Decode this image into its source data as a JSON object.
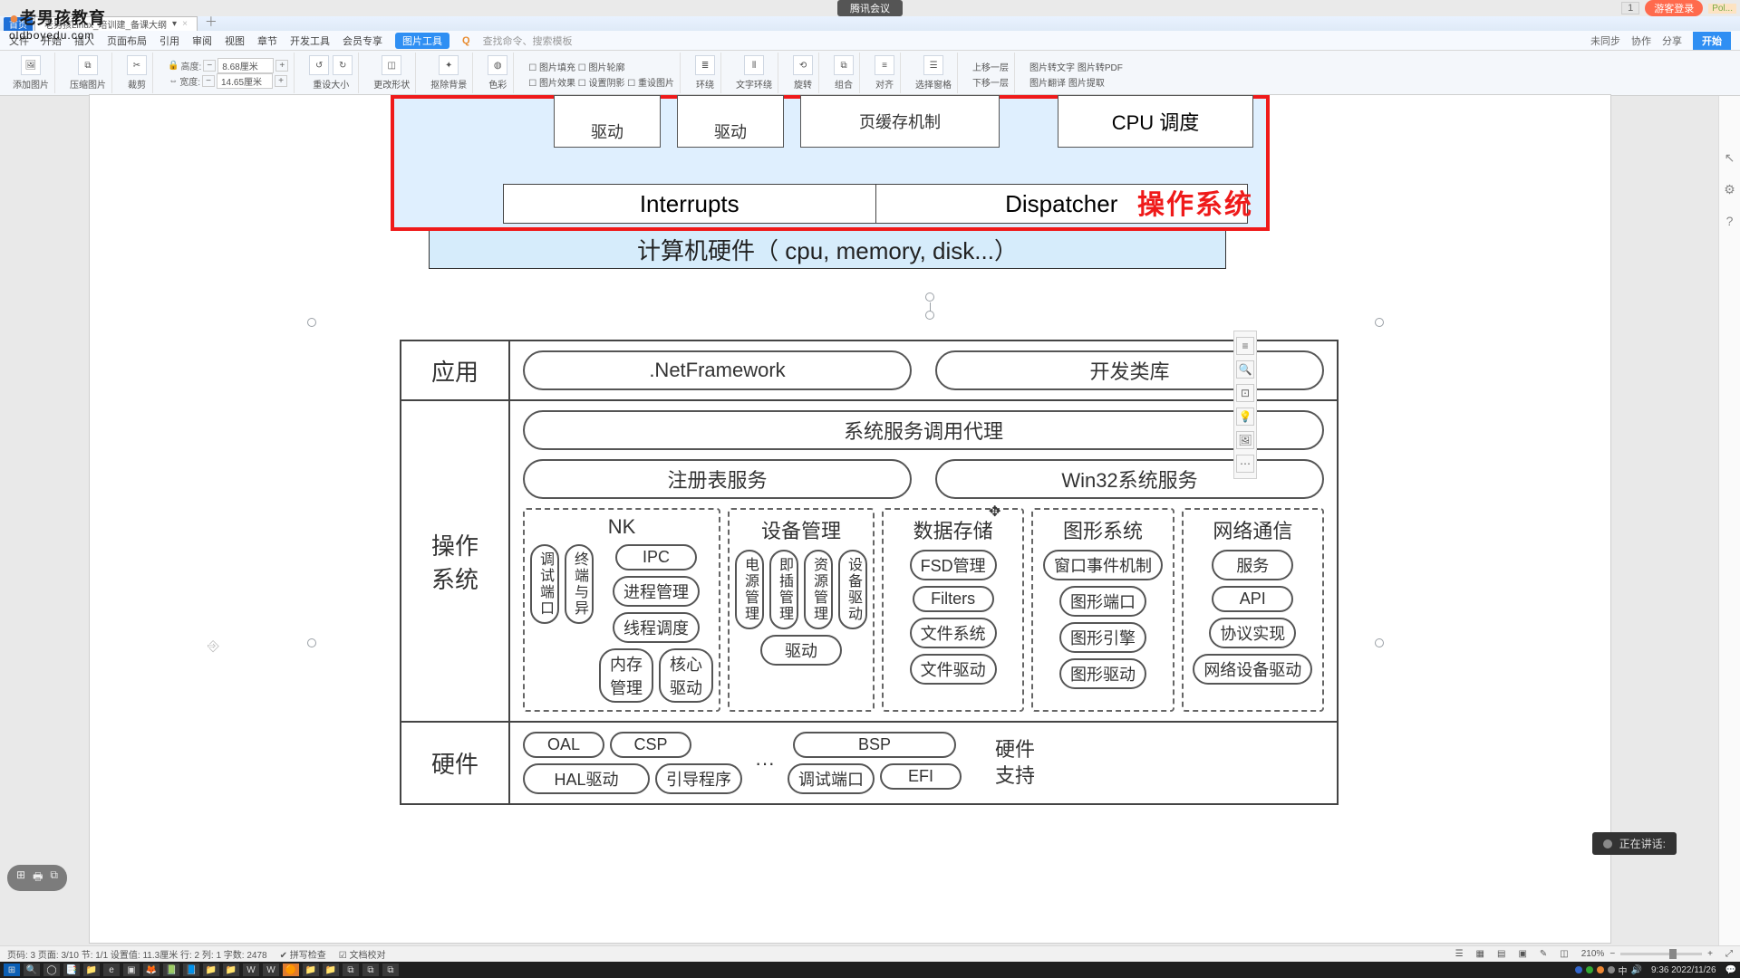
{
  "window": {
    "meeting_badge": "腾讯会议",
    "tab_prefix": "首页",
    "doc_tab": "老男孩Linux_培训建_备课大纲",
    "login": "游客登录",
    "counter": "1",
    "mini": "Pol..."
  },
  "menu": {
    "items": [
      "文件",
      "开始",
      "插入",
      "页面布局",
      "引用",
      "审阅",
      "视图",
      "章节",
      "开发工具",
      "会员专享"
    ],
    "active": "图片工具",
    "search_placeholder": "查找命令、搜索模板",
    "right": {
      "sync": "未同步",
      "coop": "协作",
      "share": "分享",
      "begin": "开始"
    }
  },
  "ribbon": {
    "add_pic": "添加图片",
    "compress": "压缩图片",
    "crop": "裁剪",
    "dim_h_lbl": "高度:",
    "dim_h_val": "8.68厘米",
    "dim_w_lbl": "宽度:",
    "dim_w_val": "14.65厘米",
    "reset": "重设大小",
    "shape": "更改形状",
    "rmbg": "抠除背景",
    "color": "色彩",
    "fill": "图片填充",
    "outline": "图片轮廓",
    "fx": "图片效果",
    "shadow": "设置阴影",
    "reset2": "重设图片",
    "wrap": "环绕",
    "align": "文字环绕",
    "rotate": "旋转",
    "combine": "组合",
    "align2": "对齐",
    "selpane": "选择窗格",
    "fwd": "上移一层",
    "back": "下移一层",
    "text": "图片转文字",
    "pdf": "图片转PDF",
    "translate": "图片翻译",
    "extract": "图片提取"
  },
  "logo": {
    "line1": "老男孩教育",
    "line2": "oldboyedu.com"
  },
  "diag_top": {
    "drv1": "驱动",
    "drv2": "驱动",
    "mem": "页缓存机制",
    "cpu": "CPU 调度",
    "os_label": "操作系统",
    "interrupts": "Interrupts",
    "dispatcher": "Dispatcher",
    "hw": "计算机硬件（ cpu, memory, disk...）"
  },
  "arch": {
    "r1": {
      "label": "应用",
      "netfx": ".NetFramework",
      "devlib": "开发类库"
    },
    "r2": {
      "label": "操作\n系统",
      "svc_proxy": "系统服务调用代理",
      "reg": "注册表服务",
      "win32": "Win32系统服务",
      "g_nk": {
        "title": "NK",
        "v1": "调试端口",
        "v2": "终端与异",
        "ipc": "IPC",
        "proc": "进程管理",
        "sched": "线程调度",
        "mem": "内存管理",
        "core": "核心驱动"
      },
      "g_dev": {
        "title": "设备管理",
        "v1": "电源管理",
        "v2": "即插管理",
        "v3": "资源管理",
        "v4": "设备驱动",
        "bottom": "驱动"
      },
      "g_store": {
        "title": "数据存储",
        "a": "FSD管理",
        "b": "Filters",
        "c": "文件系统",
        "d": "文件驱动"
      },
      "g_gfx": {
        "title": "图形系统",
        "a": "窗口事件机制",
        "b": "图形端口",
        "c": "图形引擎",
        "d": "图形驱动"
      },
      "g_net": {
        "title": "网络通信",
        "a": "服务",
        "b": "API",
        "c": "协议实现",
        "d": "网络设备驱动"
      }
    },
    "r3": {
      "label": "硬件",
      "oal": "OAL",
      "csp": "CSP",
      "hal": "HAL驱动",
      "boot": "引导程序",
      "dots": "···",
      "bsp": "BSP",
      "dbgport": "调试端口",
      "efi": "EFI",
      "hw_support": "硬件\n支持"
    }
  },
  "float": [
    "≡",
    "🔍",
    "⊡",
    "💡",
    "🖼",
    "⋯"
  ],
  "tray": [
    "⊞",
    "🖶",
    "⧉"
  ],
  "speak": "正在讲话:",
  "status": {
    "pages": "页码: 3   页面: 3/10   节: 1/1   设置值: 11.3厘米   行: 2   列: 1   字数: 2478",
    "rec": "拼写检查",
    "doc": "文档校对",
    "zoom": "210%"
  },
  "taskbar": {
    "items": [
      "⊞",
      "🔍",
      "◯",
      "📑",
      "📁",
      "e",
      "▣",
      "🦊",
      "📗",
      "📘",
      "📁",
      "📁",
      "W",
      "W",
      "🟠",
      "📁",
      "📁",
      "⧉",
      "⧉",
      "⧉"
    ],
    "clock": "9:36",
    "date": "2022/11/26"
  }
}
